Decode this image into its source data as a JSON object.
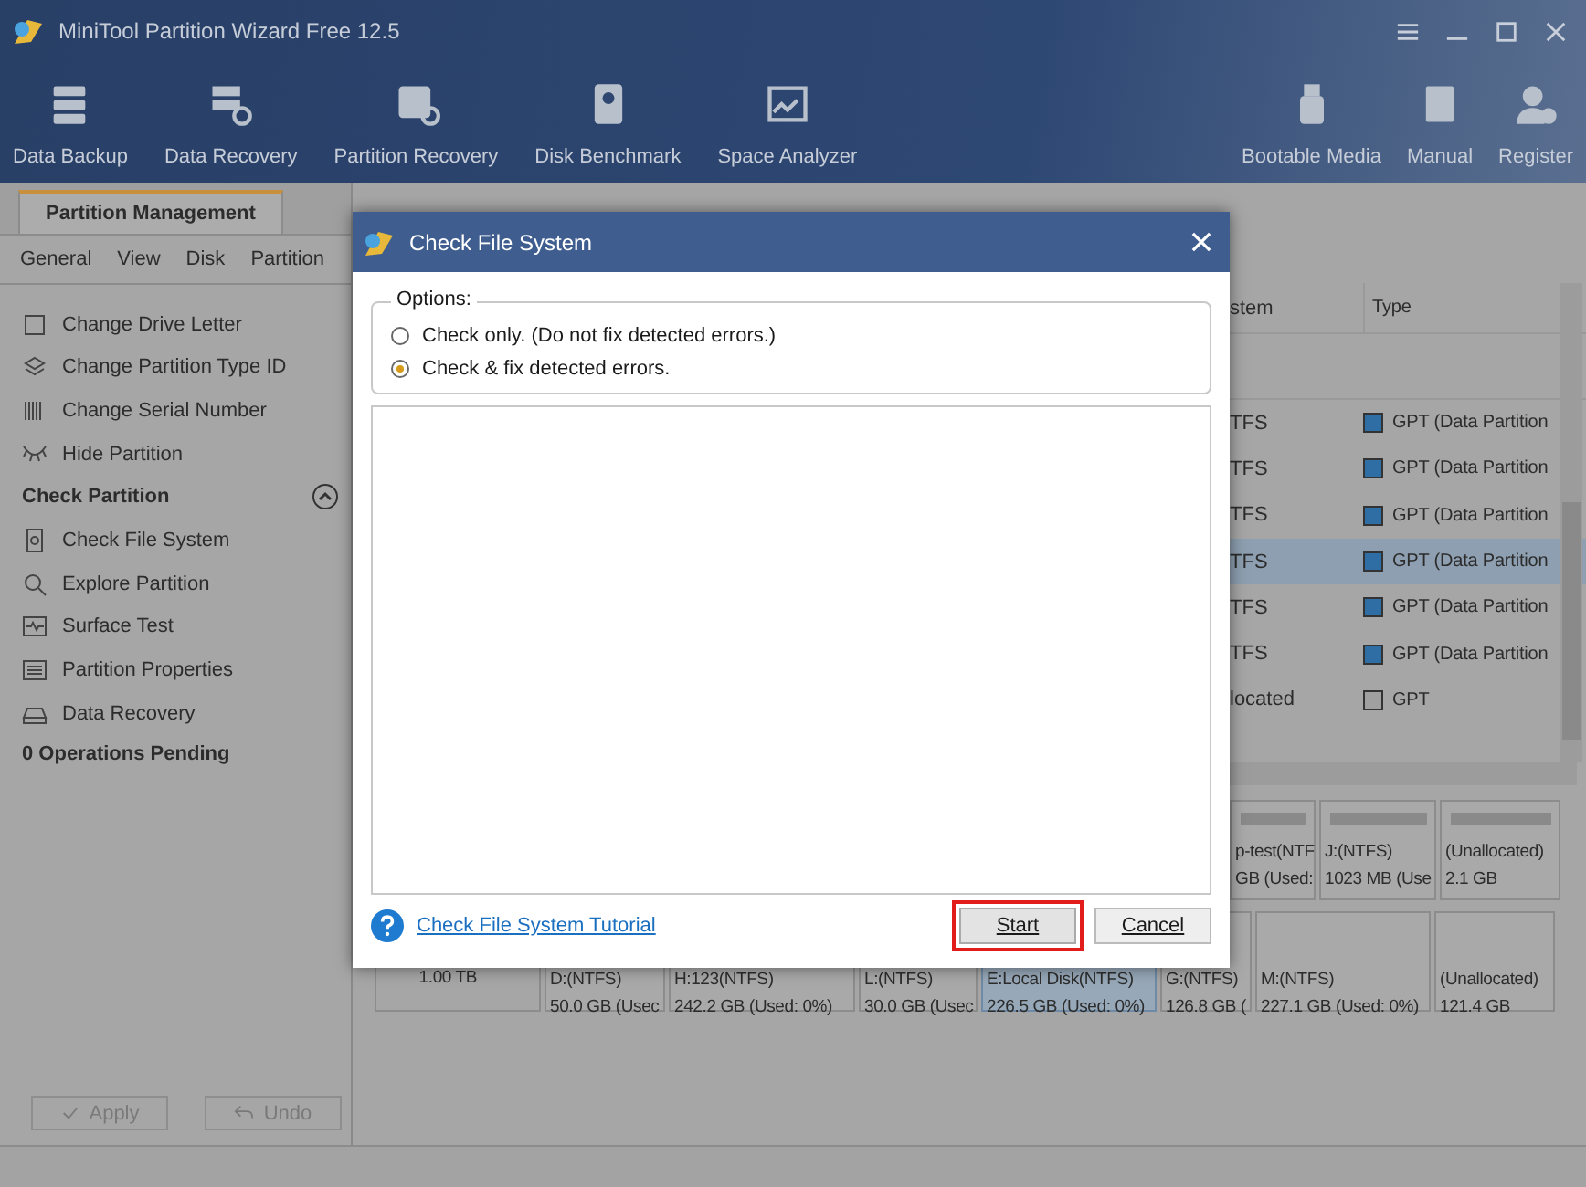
{
  "window": {
    "title": "MiniTool Partition Wizard Free 12.5"
  },
  "toolbar": {
    "left": [
      {
        "label": "Data Backup",
        "kind": "backup"
      },
      {
        "label": "Data Recovery",
        "kind": "recovery"
      },
      {
        "label": "Partition Recovery",
        "kind": "partition"
      },
      {
        "label": "Disk Benchmark",
        "kind": "benchmark"
      },
      {
        "label": "Space Analyzer",
        "kind": "analyzer"
      }
    ],
    "right": [
      {
        "label": "Bootable Media",
        "kind": "usb"
      },
      {
        "label": "Manual",
        "kind": "book"
      },
      {
        "label": "Register",
        "kind": "user"
      }
    ]
  },
  "tab": {
    "label": "Partition Management",
    "selected": true
  },
  "menu": [
    "General",
    "View",
    "Disk",
    "Partition"
  ],
  "sidebar": {
    "items": [
      {
        "label": "Change Drive Letter",
        "kind": "letter"
      },
      {
        "label": "Change Partition Type ID",
        "kind": "layers"
      },
      {
        "label": "Change Serial Number",
        "kind": "barcode"
      },
      {
        "label": "Hide Partition",
        "kind": "eye"
      }
    ],
    "section": {
      "title": "Check Partition",
      "expanded": true,
      "items": [
        {
          "label": "Check File System",
          "kind": "doc"
        },
        {
          "label": "Explore Partition",
          "kind": "search"
        },
        {
          "label": "Surface Test",
          "kind": "wave"
        },
        {
          "label": "Partition Properties",
          "kind": "list"
        },
        {
          "label": "Data Recovery",
          "kind": "drive"
        }
      ]
    },
    "pending": "0 Operations Pending"
  },
  "actions": [
    {
      "label": "Apply",
      "kind": "check",
      "disabled": true
    },
    {
      "label": "Undo",
      "kind": "undo",
      "disabled": true
    }
  ],
  "table": {
    "columns": [
      "stem",
      "Type"
    ],
    "rows": [
      {
        "file_system": "TFS",
        "type": "GPT (Data Partition",
        "color": "#2f6ea5",
        "selected": false
      },
      {
        "file_system": "TFS",
        "type": "GPT (Data Partition",
        "color": "#2f6ea5",
        "selected": false
      },
      {
        "file_system": "TFS",
        "type": "GPT (Data Partition",
        "color": "#2f6ea5",
        "selected": false
      },
      {
        "file_system": "TFS",
        "type": "GPT (Data Partition",
        "color": "#2f6ea5",
        "selected": true
      },
      {
        "file_system": "TFS",
        "type": "GPT (Data Partition",
        "color": "#2f6ea5",
        "selected": false
      },
      {
        "file_system": "TFS",
        "type": "GPT (Data Partition",
        "color": "#2f6ea5",
        "selected": false
      },
      {
        "file_system": "located",
        "type": "GPT",
        "color": "#a0a0a0",
        "selected": false
      }
    ]
  },
  "disk_map": {
    "row_1": [
      {
        "name": "p-test(NTF",
        "size": "GB (Used:",
        "selected": false
      },
      {
        "name": "J:(NTFS)",
        "size": "1023 MB (Use",
        "selected": false
      },
      {
        "name": "(Unallocated)",
        "size": "2.1 GB",
        "selected": false
      }
    ],
    "disk_2": {
      "size": "1.00 TB"
    },
    "row_2": [
      {
        "name": "D:(NTFS)",
        "size": "50.0 GB (Usec",
        "selected": false
      },
      {
        "name": "H:123(NTFS)",
        "size": "242.2 GB (Used: 0%)",
        "selected": false
      },
      {
        "name": "L:(NTFS)",
        "size": "30.0 GB (Usec",
        "selected": false
      },
      {
        "name": "E:Local Disk(NTFS)",
        "size": "226.5 GB (Used: 0%)",
        "selected": true
      },
      {
        "name": "G:(NTFS)",
        "size": "126.8 GB (",
        "selected": false
      },
      {
        "name": "M:(NTFS)",
        "size": "227.1 GB (Used: 0%)",
        "selected": false
      },
      {
        "name": "(Unallocated)",
        "size": "121.4 GB",
        "selected": false
      }
    ]
  },
  "dialog": {
    "title": "Check File System",
    "options_label": "Options:",
    "options": [
      {
        "label": "Check only. (Do not fix detected errors.)",
        "selected": false
      },
      {
        "label": "Check & fix detected errors.",
        "selected": true
      }
    ],
    "link": "Check File System Tutorial",
    "buttons": [
      {
        "label": "Start",
        "highlighted": true
      },
      {
        "label": "Cancel",
        "highlighted": false
      }
    ]
  }
}
